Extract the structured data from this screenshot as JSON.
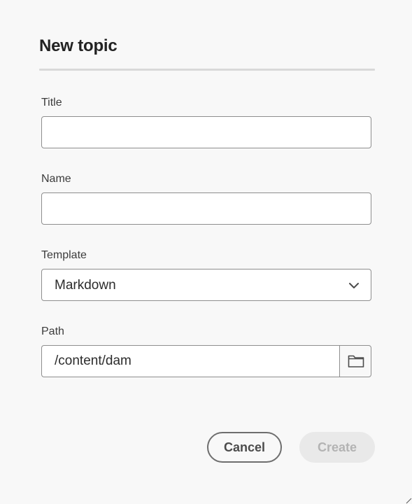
{
  "dialog": {
    "title": "New topic"
  },
  "fields": {
    "title": {
      "label": "Title",
      "value": "",
      "placeholder": ""
    },
    "name": {
      "label": "Name",
      "value": "",
      "placeholder": ""
    },
    "template": {
      "label": "Template",
      "selected": "Markdown"
    },
    "path": {
      "label": "Path",
      "value": "/content/dam"
    }
  },
  "icons": {
    "template_dropdown": "chevron-down-icon",
    "path_browse": "folder-icon",
    "resize": "resize-handle-icon"
  },
  "actions": {
    "cancel_label": "Cancel",
    "create_label": "Create",
    "create_enabled": false
  },
  "colors": {
    "background": "#f8f8f8",
    "border": "#8e8e8e",
    "disabled_bg": "#e9e9e9",
    "disabled_text": "#b3b3b3"
  }
}
